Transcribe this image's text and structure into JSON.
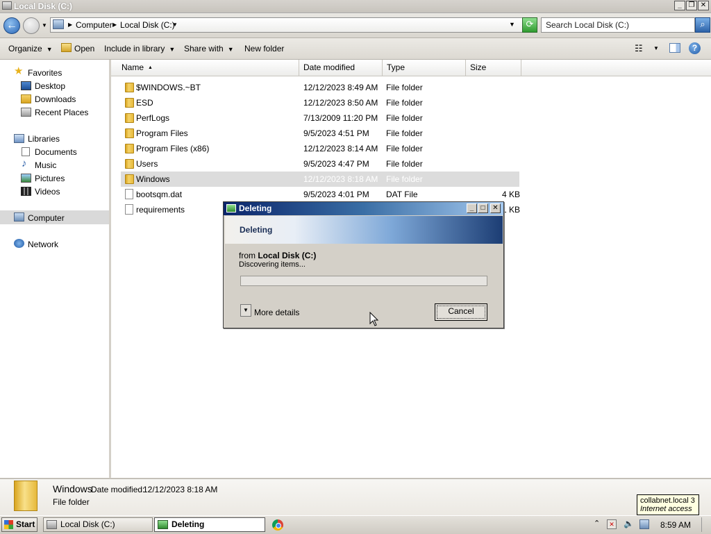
{
  "window": {
    "title": "Local Disk (C:)"
  },
  "address": {
    "crumbs": [
      "Computer",
      "Local Disk (C:)"
    ],
    "search_placeholder": "Search Local Disk (C:)"
  },
  "toolbar": {
    "organize": "Organize",
    "open": "Open",
    "include_in_library": "Include in library",
    "share_with": "Share with",
    "new_folder": "New folder"
  },
  "nav": {
    "favorites": "Favorites",
    "desktop": "Desktop",
    "downloads": "Downloads",
    "recent_places": "Recent Places",
    "libraries": "Libraries",
    "documents": "Documents",
    "music": "Music",
    "pictures": "Pictures",
    "videos": "Videos",
    "computer": "Computer",
    "network": "Network"
  },
  "columns": {
    "name": "Name",
    "date_modified": "Date modified",
    "type": "Type",
    "size": "Size"
  },
  "files": [
    {
      "name": "$WINDOWS.~BT",
      "date": "12/12/2023 8:49 AM",
      "type": "File folder",
      "size": "",
      "kind": "folder"
    },
    {
      "name": "ESD",
      "date": "12/12/2023 8:50 AM",
      "type": "File folder",
      "size": "",
      "kind": "folder"
    },
    {
      "name": "PerfLogs",
      "date": "7/13/2009 11:20 PM",
      "type": "File folder",
      "size": "",
      "kind": "folder"
    },
    {
      "name": "Program Files",
      "date": "9/5/2023 4:51 PM",
      "type": "File folder",
      "size": "",
      "kind": "folder"
    },
    {
      "name": "Program Files (x86)",
      "date": "12/12/2023 8:14 AM",
      "type": "File folder",
      "size": "",
      "kind": "folder"
    },
    {
      "name": "Users",
      "date": "9/5/2023 4:47 PM",
      "type": "File folder",
      "size": "",
      "kind": "folder"
    },
    {
      "name": "Windows",
      "date": "12/12/2023 8:18 AM",
      "type": "File folder",
      "size": "",
      "kind": "folder"
    },
    {
      "name": "bootsqm.dat",
      "date": "9/5/2023 4:01 PM",
      "type": "DAT File",
      "size": "4 KB",
      "kind": "file"
    },
    {
      "name": "requirements",
      "date": "",
      "type": "",
      "size": "1 KB",
      "kind": "file"
    }
  ],
  "details": {
    "name": "Windows",
    "date_label": "Date modified:",
    "date_value": "12/12/2023 8:18 AM",
    "type": "File folder"
  },
  "dialog": {
    "title": "Deleting",
    "heading": "Deleting",
    "from_prefix": "from",
    "from_location": "Local Disk (C:)",
    "status": "Discovering items...",
    "progress": 0,
    "more_details": "More details",
    "cancel": "Cancel"
  },
  "tooltip": {
    "line1": "collabnet.local  3",
    "line2": "Internet access"
  },
  "taskbar": {
    "start": "Start",
    "task_explorer": "Local Disk (C:)",
    "task_deleting": "Deleting",
    "clock": "8:59 AM"
  }
}
